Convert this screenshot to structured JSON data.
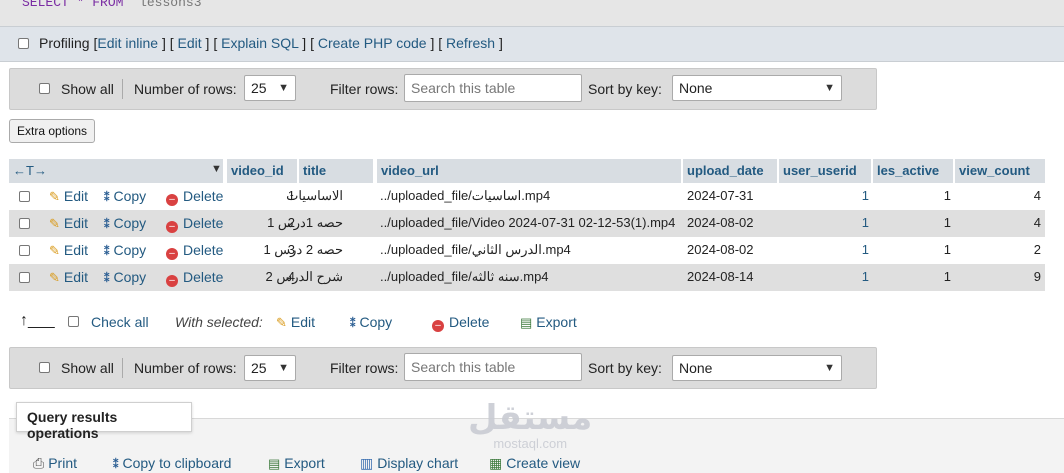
{
  "sql": {
    "keyword": "SELECT",
    "star": "*",
    "from": "FROM",
    "table": "`lessons3`"
  },
  "profiling": {
    "label": "Profiling",
    "links": [
      "Edit inline",
      "Edit",
      "Explain SQL",
      "Create PHP code",
      "Refresh"
    ]
  },
  "nav": {
    "show_all": "Show all",
    "number_of_rows_label": "Number of rows:",
    "rows_value": "25",
    "filter_label": "Filter rows:",
    "search_placeholder": "Search this table",
    "sort_label": "Sort by key:",
    "sort_value": "None"
  },
  "extra_options": "Extra options",
  "columns": [
    "video_id",
    "title",
    "video_url",
    "upload_date",
    "user_userid",
    "les_active",
    "view_count"
  ],
  "row_actions": {
    "edit": "Edit",
    "copy": "Copy",
    "delete": "Delete"
  },
  "rows": [
    {
      "video_id": "1",
      "title": "الاساسيات",
      "video_url": "../uploaded_file/اساسيات.mp4",
      "upload_date": "2024-07-31",
      "user_userid": "1",
      "les_active": "1",
      "view_count": "4"
    },
    {
      "video_id": "2",
      "title": "حصه 1درس 1",
      "video_url": "../uploaded_file/Video 2024-07-31 02-12-53(1).mp4",
      "upload_date": "2024-08-02",
      "user_userid": "1",
      "les_active": "1",
      "view_count": "4"
    },
    {
      "video_id": "3",
      "title": "حصه 2 درس 1",
      "video_url": "../uploaded_file/الدرس الثاني.mp4",
      "upload_date": "2024-08-02",
      "user_userid": "1",
      "les_active": "1",
      "view_count": "2"
    },
    {
      "video_id": "4",
      "title": "شرح الدرس 2",
      "video_url": "../uploaded_file/سنه ثالثه.mp4",
      "upload_date": "2024-08-14",
      "user_userid": "1",
      "les_active": "1",
      "view_count": "9"
    }
  ],
  "with_selected": {
    "check_all": "Check all",
    "label": "With selected:",
    "edit": "Edit",
    "copy": "Copy",
    "delete": "Delete",
    "export": "Export"
  },
  "query_results": {
    "title": "Query results operations",
    "ops": [
      "Print",
      "Copy to clipboard",
      "Export",
      "Display chart",
      "Create view"
    ]
  },
  "watermark": {
    "text": "مستقل",
    "sub": "mostaql.com"
  },
  "colors": {
    "link": "#235a81",
    "header_bg": "#d8dde2",
    "row_alt": "#dfdfdf",
    "delete": "#d94141"
  }
}
